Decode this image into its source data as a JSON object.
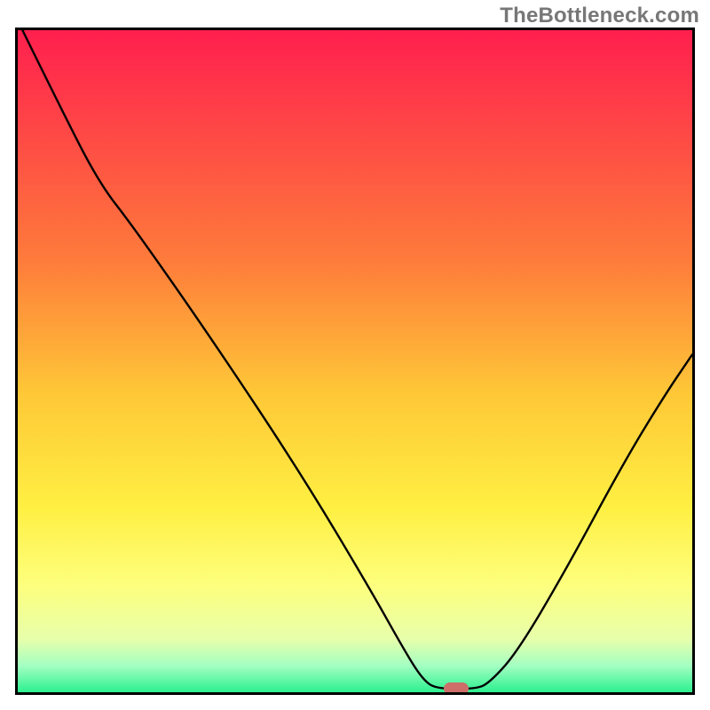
{
  "watermark": "TheBottleneck.com",
  "chart_data": {
    "type": "line",
    "title": "",
    "xlabel": "",
    "ylabel": "",
    "xlim": [
      0,
      100
    ],
    "ylim": [
      0,
      100
    ],
    "gradient_stops": [
      {
        "offset": 0,
        "color": "#ff1f4e"
      },
      {
        "offset": 35,
        "color": "#fe7c3b"
      },
      {
        "offset": 55,
        "color": "#fec837"
      },
      {
        "offset": 72,
        "color": "#ffef42"
      },
      {
        "offset": 84,
        "color": "#fdff7e"
      },
      {
        "offset": 92,
        "color": "#e7ffab"
      },
      {
        "offset": 96,
        "color": "#a3ffc2"
      },
      {
        "offset": 100,
        "color": "#2cf090"
      }
    ],
    "series": [
      {
        "name": "bottleneck-curve",
        "color": "#000000",
        "points": [
          {
            "x": 0.7,
            "y": 100.0
          },
          {
            "x": 6.0,
            "y": 89.0
          },
          {
            "x": 12.0,
            "y": 77.0
          },
          {
            "x": 17.0,
            "y": 70.5
          },
          {
            "x": 29.0,
            "y": 53.0
          },
          {
            "x": 42.0,
            "y": 33.0
          },
          {
            "x": 52.0,
            "y": 16.0
          },
          {
            "x": 57.5,
            "y": 6.0
          },
          {
            "x": 60.0,
            "y": 2.0
          },
          {
            "x": 62.0,
            "y": 0.5
          },
          {
            "x": 68.0,
            "y": 0.5
          },
          {
            "x": 70.0,
            "y": 1.5
          },
          {
            "x": 74.0,
            "y": 6.0
          },
          {
            "x": 81.0,
            "y": 18.0
          },
          {
            "x": 90.0,
            "y": 35.0
          },
          {
            "x": 96.0,
            "y": 45.0
          },
          {
            "x": 100.0,
            "y": 51.0
          }
        ]
      }
    ],
    "marker": {
      "x": 65.0,
      "y": 0.6,
      "color": "#cd6e68"
    }
  }
}
